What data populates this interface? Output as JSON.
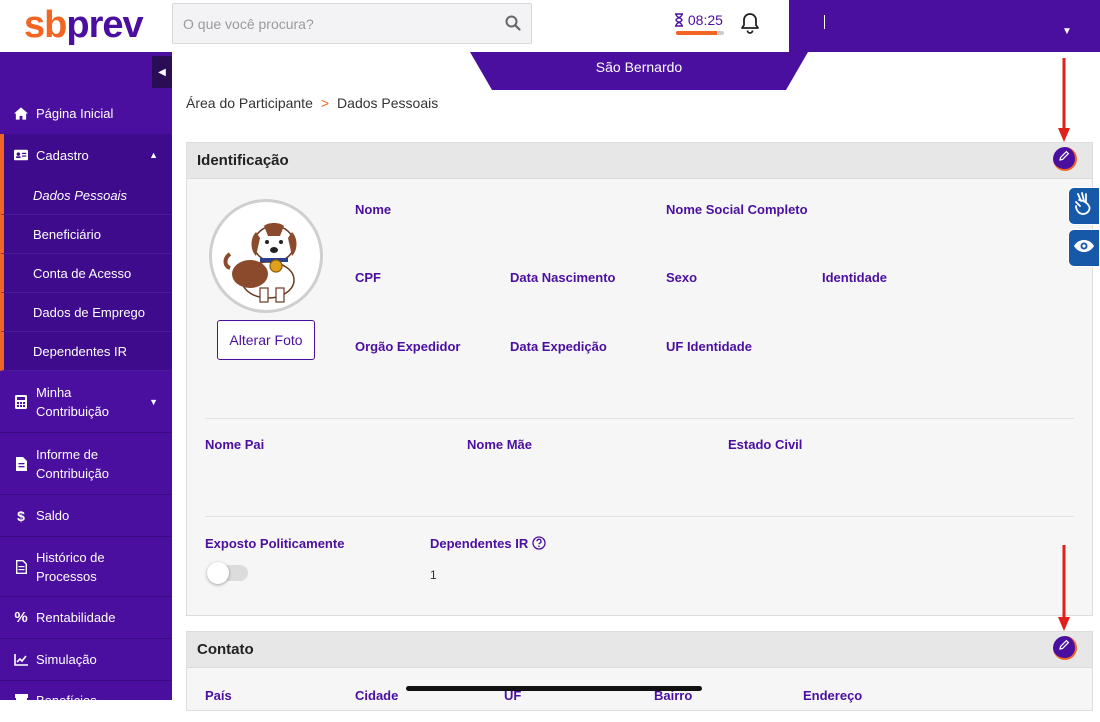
{
  "brand": {
    "logo_sb": "sb",
    "logo_prev": "prev",
    "primary_color": "#4b0fa0",
    "accent_color": "#f26522"
  },
  "header": {
    "search_placeholder": "O que você procura?",
    "timer": "08:25",
    "timer_progress": 0.85
  },
  "sidebar": {
    "items": [
      {
        "label": "Página Inicial",
        "icon": "home-icon"
      },
      {
        "label": "Cadastro",
        "icon": "id-card-icon"
      },
      {
        "label": "Minha Contribuição",
        "icon": "calculator-icon"
      },
      {
        "label": "Informe de Contribuição",
        "icon": "file-icon"
      },
      {
        "label": "Saldo",
        "icon": "dollar-icon"
      },
      {
        "label": "Histórico de Processos",
        "icon": "document-icon"
      },
      {
        "label": "Rentabilidade",
        "icon": "percent-icon"
      },
      {
        "label": "Simulação",
        "icon": "chart-line-icon"
      },
      {
        "label": "Benefícios",
        "icon": "gift-icon"
      }
    ],
    "cadastro_sub": [
      "Dados Pessoais",
      "Beneficiário",
      "Conta de Acesso",
      "Dados de Emprego",
      "Dependentes IR"
    ]
  },
  "banner": {
    "text": "São Bernardo"
  },
  "breadcrumb": {
    "root": "Área do Participante",
    "separator": ">",
    "current": "Dados Pessoais"
  },
  "identificacao": {
    "title": "Identificação",
    "change_photo": "Alterar Foto",
    "fields": {
      "nome": "Nome",
      "nome_social": "Nome Social Completo",
      "cpf": "CPF",
      "data_nascimento": "Data Nascimento",
      "sexo": "Sexo",
      "identidade": "Identidade",
      "orgao_expedidor": "Orgão Expedidor",
      "data_expedicao": "Data Expedição",
      "uf_identidade": "UF Identidade",
      "nome_pai": "Nome Pai",
      "nome_mae": "Nome Mãe",
      "estado_civil": "Estado Civil",
      "exposto": "Exposto Politicamente",
      "dependentes_ir": "Dependentes IR"
    },
    "values": {
      "dependentes_ir": "1",
      "exposto_politicamente": false
    }
  },
  "contato": {
    "title": "Contato",
    "fields": {
      "pais": "País",
      "cidade": "Cidade",
      "uf": "UF",
      "bairro": "Bairro",
      "endereco": "Endereço"
    }
  }
}
